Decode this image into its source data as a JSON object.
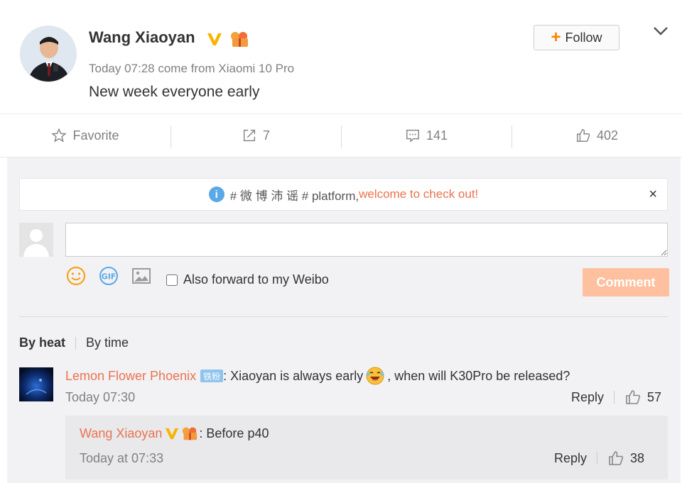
{
  "post": {
    "author": "Wang Xiaoyan",
    "meta": "Today 07:28 come from Xiaomi 10 Pro",
    "text": "New week everyone early",
    "follow_label": "Follow"
  },
  "actions": {
    "favorite": "Favorite",
    "forward_count": "7",
    "comment_count": "141",
    "like_count": "402"
  },
  "notice": {
    "prefix": "# 微 博 沛 谣 # platform, ",
    "highlight": "welcome to check out!",
    "close": "×"
  },
  "composer": {
    "input_value": "",
    "forward_label": "Also forward to my Weibo",
    "comment_button": "Comment"
  },
  "sort": {
    "by_heat": "By heat",
    "by_time": "By time"
  },
  "comments": [
    {
      "user": "Lemon Flower Phoenix",
      "badge": "铁粉",
      "text_before": ": Xiaoyan is always early",
      "text_after": ", when will K30Pro be released?",
      "time": "Today 07:30",
      "reply_label": "Reply",
      "likes": "57"
    }
  ],
  "reply": {
    "user": "Wang Xiaoyan",
    "text": ": Before p40",
    "time": "Today at 07:33",
    "reply_label": "Reply",
    "likes": "38"
  },
  "colors": {
    "orange_accent": "#ff8200",
    "username": "#eb7350",
    "comment_button": "#ffc09f",
    "info_blue": "#5aa8e6"
  }
}
